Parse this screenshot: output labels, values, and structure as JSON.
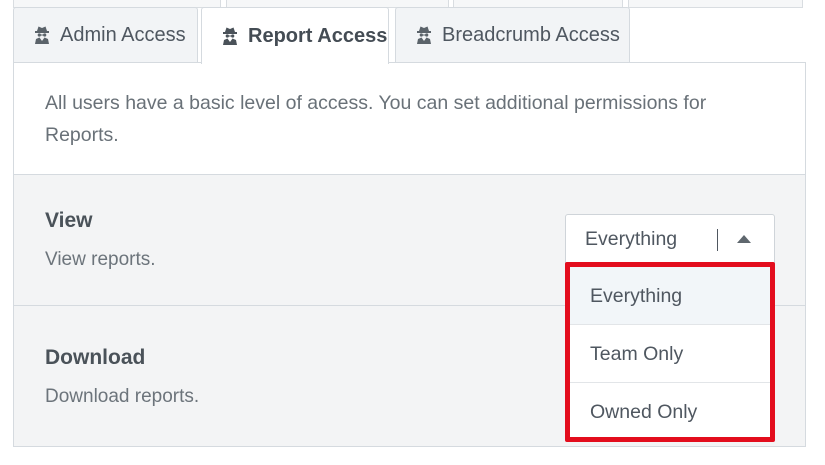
{
  "tabs": [
    {
      "label": "Admin Access",
      "active": false
    },
    {
      "label": "Report Access",
      "active": true
    },
    {
      "label": "Breadcrumb Access",
      "active": false
    }
  ],
  "intro_text": "All users have a basic level of access. You can set additional permissions for Reports.",
  "permissions": {
    "view": {
      "title": "View",
      "description": "View reports.",
      "selected": "Everything"
    },
    "download": {
      "title": "Download",
      "description": "Download reports."
    }
  },
  "dropdown": {
    "options": [
      "Everything",
      "Team Only",
      "Owned Only"
    ],
    "selected_index": 0,
    "highlight_color": "#e30d1d"
  },
  "icons": {
    "tab_icon": "user-secret-icon",
    "caret": "caret-up-icon"
  }
}
